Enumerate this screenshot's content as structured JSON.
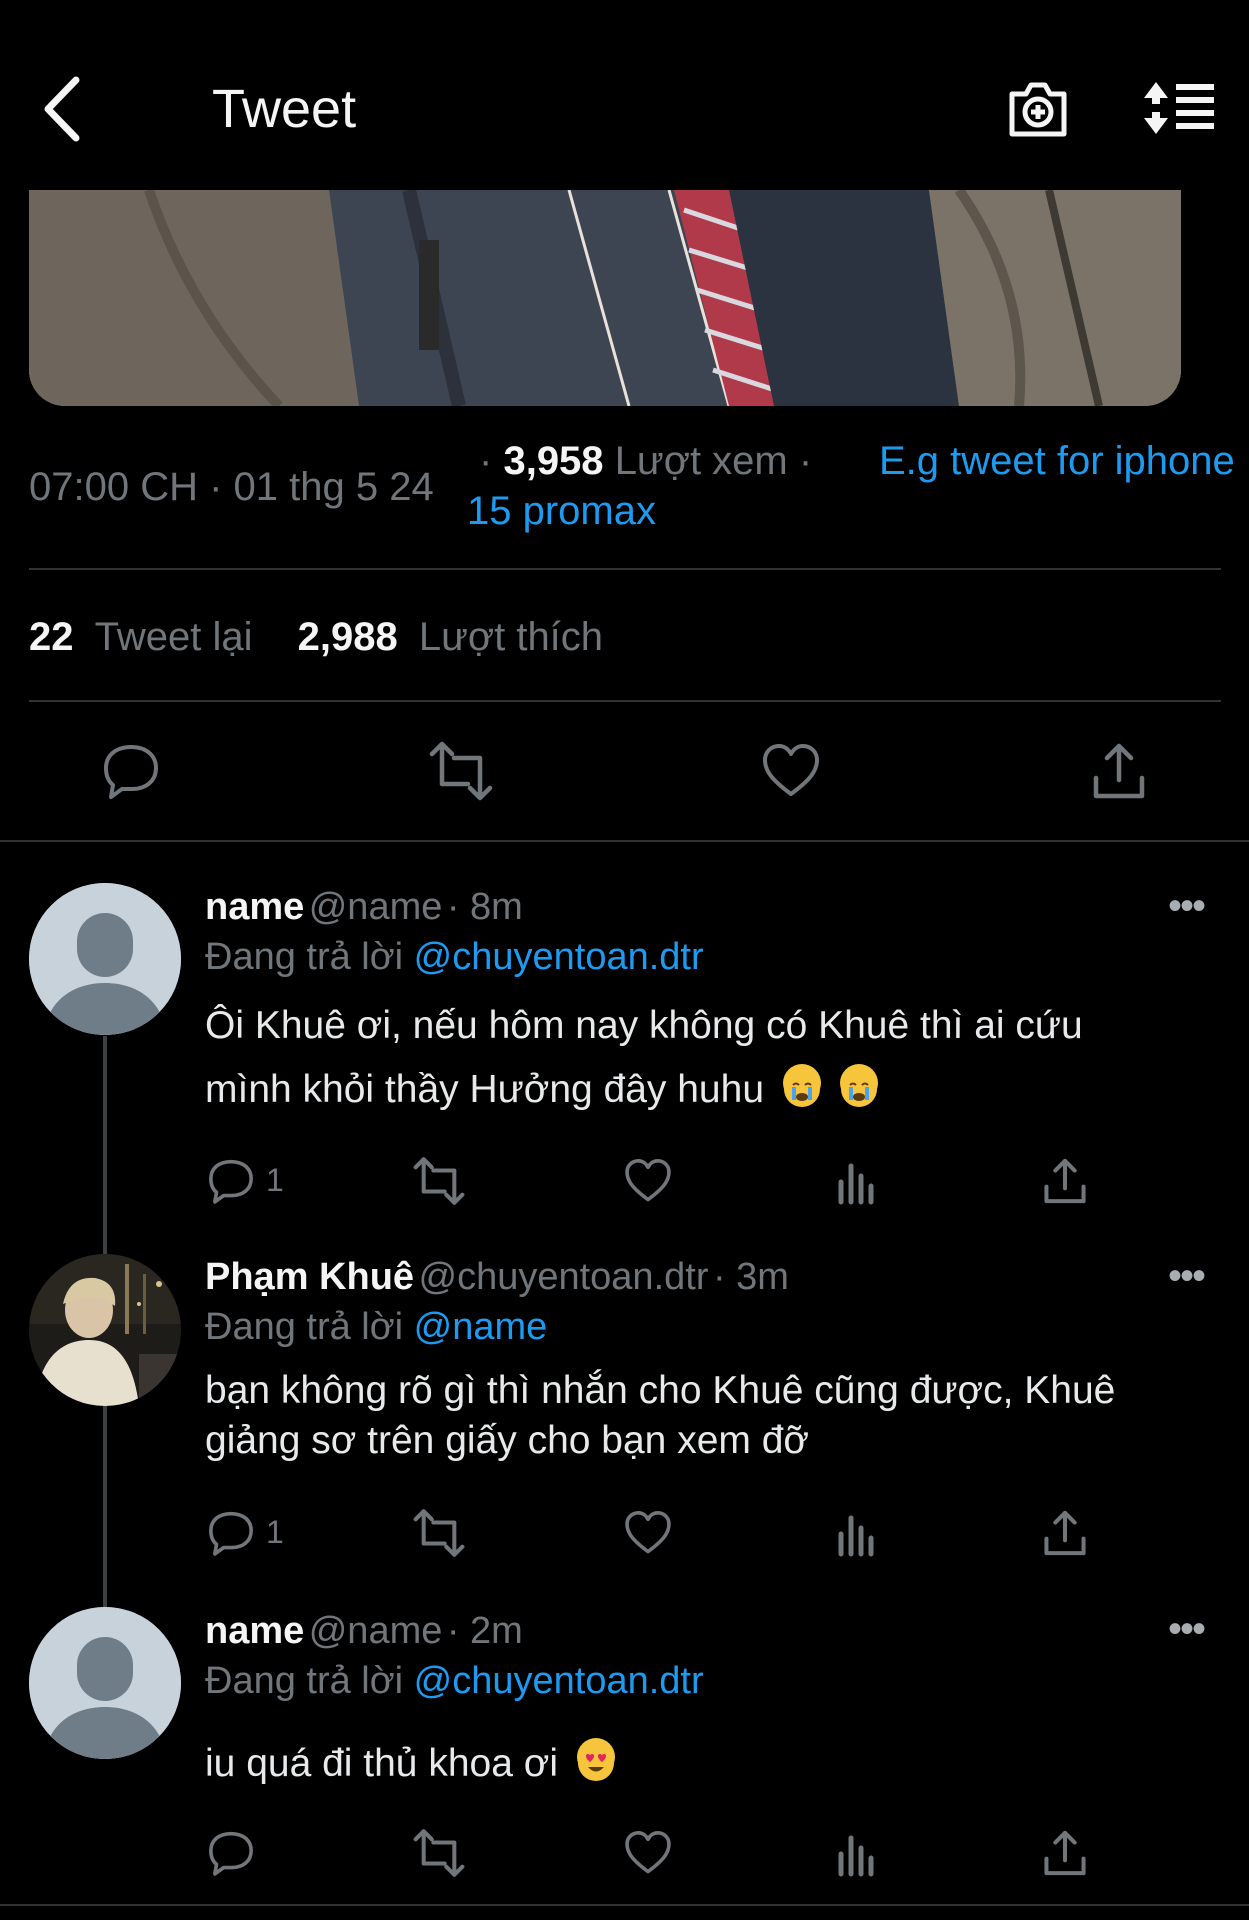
{
  "header": {
    "title": "Tweet",
    "back_icon": "chevron-left-icon",
    "camera_icon": "camera-add-icon",
    "sort_icon": "sort-icon"
  },
  "tweet": {
    "meta_time": "07:00 CH · 01 thg 5 24",
    "meta_sep": "·",
    "views_count": "3,958",
    "views_label": "Lượt xem",
    "meta_sep2": "·",
    "source": "E.g tweet for iphone 15 promax",
    "retweets_count": "22",
    "retweets_label": "Tweet lại",
    "likes_count": "2,988",
    "likes_label": "Lượt thích"
  },
  "replies": [
    {
      "name": "name",
      "handle": "@name",
      "time": "· 8m",
      "replying_label": "Đang trả lời",
      "replying_to": "@chuyentoan.dtr",
      "text_line1": "Ôi Khuê ơi, nếu hôm nay không có Khuê thì ai cứu",
      "text_line2": "mình khỏi thầy Hưởng đây huhu",
      "reply_count": "1"
    },
    {
      "name": "Phạm Khuê",
      "handle": "@chuyentoan.dtr",
      "time": "· 3m",
      "replying_label": "Đang trả lời",
      "replying_to": "@name",
      "text_line1": "bạn không rõ gì thì nhắn cho Khuê cũng được, Khuê",
      "text_line2": "giảng sơ trên giấy cho bạn xem đỡ",
      "reply_count": "1"
    },
    {
      "name": "name",
      "handle": "@name",
      "time": "· 2m",
      "replying_label": "Đang trả lời",
      "replying_to": "@chuyentoan.dtr",
      "text_line1": "iu quá đi thủ khoa ơi",
      "reply_count": ""
    }
  ],
  "colors": {
    "background": "#000000",
    "accent": "#1d9bf0",
    "muted": "#71767b",
    "text": "#e7e9ea"
  }
}
